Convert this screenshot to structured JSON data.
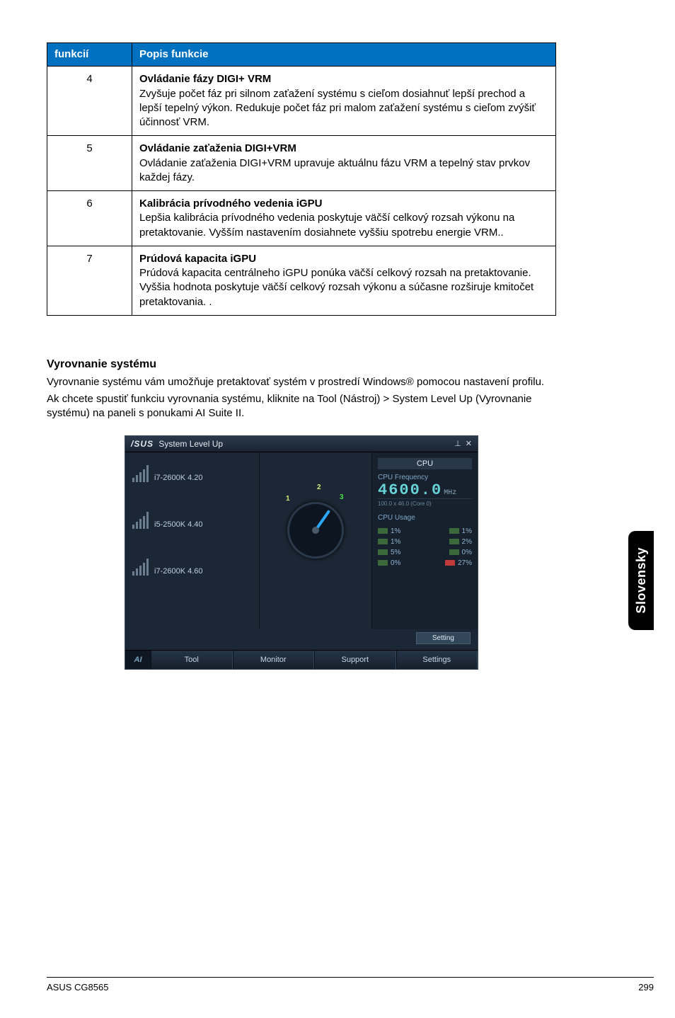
{
  "table": {
    "headers": {
      "col1": "funkcií",
      "col2": "Popis funkcie"
    },
    "rows": [
      {
        "num": "4",
        "title": "Ovládanie fázy DIGI+ VRM",
        "desc": "Zvyšuje počet fáz pri silnom zaťažení systému s cieľom dosiahnuť lepší prechod a lepší tepelný výkon. Redukuje počet fáz pri malom zaťažení systému s cieľom zvýšiť účinnosť VRM."
      },
      {
        "num": "5",
        "title": "Ovládanie zaťaženia DIGI+VRM",
        "desc": "Ovládanie zaťaženia DIGI+VRM upravuje aktuálnu fázu VRM a tepelný stav prvkov každej fázy."
      },
      {
        "num": "6",
        "title": "Kalibrácia prívodného vedenia iGPU",
        "desc": "Lepšia kalibrácia prívodného vedenia poskytuje väčší celkový rozsah výkonu na pretaktovanie. Vyšším nastavením dosiahnete vyššiu spotrebu energie VRM.."
      },
      {
        "num": "7",
        "title": "Prúdová kapacita iGPU",
        "desc": "Prúdová kapacita centrálneho iGPU ponúka väčší celkový rozsah na pretaktovanie. Vyššia hodnota poskytuje väčší celkový rozsah výkonu a súčasne rozširuje kmitočet pretaktovania.  ."
      }
    ]
  },
  "section": {
    "heading": "Vyrovnanie systému",
    "p1": "Vyrovnanie systému vám umožňuje pretaktovať systém v prostredí Windows® pomocou nastavení profilu.",
    "p2": "Ak chcete spustiť funkciu vyrovnania systému, kliknite na Tool (Nástroj) > System Level Up (Vyrovnanie systému) na paneli s ponukami AI Suite II."
  },
  "side_tab": "Slovensky",
  "app": {
    "brand": "/SUS",
    "title": "System Level Up",
    "win": {
      "pin": "⊥",
      "close": "✕"
    },
    "profiles": [
      {
        "name": "i7-2600K 4.20"
      },
      {
        "name": "i5-2500K 4.40"
      },
      {
        "name": "i7-2600K 4.60"
      }
    ],
    "gauge": {
      "n1": "1",
      "n2": "2",
      "n3": "3"
    },
    "right": {
      "head": "CPU",
      "sub": "CPU Frequency",
      "freq_val": "4600.0",
      "freq_unit": "MHz",
      "detail": "100.0 x 46.0 (Core 0)",
      "usage_label": "CPU Usage",
      "usage": [
        {
          "l": "1%",
          "r": "1%"
        },
        {
          "l": "1%",
          "r": "2%"
        },
        {
          "l": "5%",
          "r": "0%"
        },
        {
          "l": "0%",
          "r": "27%"
        }
      ]
    },
    "slider_label": "Setting",
    "tabs": {
      "tool": "Tool",
      "monitor": "Monitor",
      "support": "Support",
      "settings": "Settings"
    }
  },
  "footer": {
    "left": "ASUS CG8565",
    "right": "299"
  }
}
